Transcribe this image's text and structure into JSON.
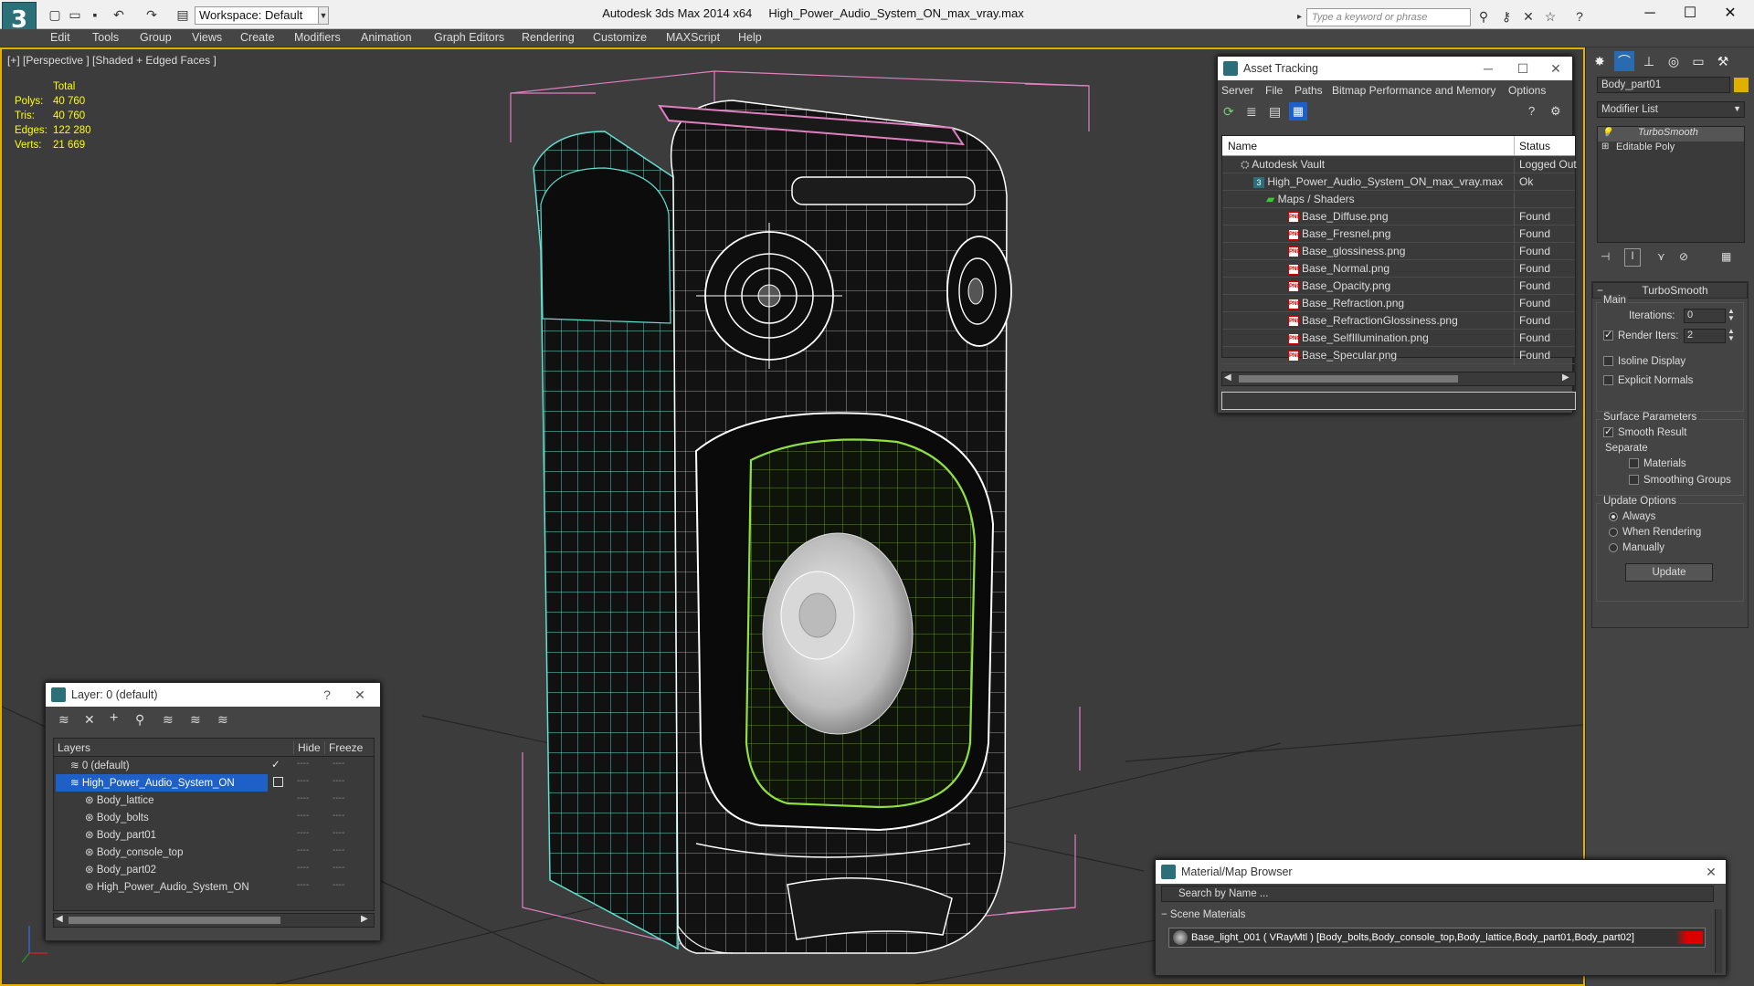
{
  "titlebar": {
    "logo": "3",
    "workspace": "Workspace: Default",
    "app_name": "Autodesk 3ds Max  2014 x64",
    "file_name": "High_Power_Audio_System_ON_max_vray.max",
    "search_placeholder": "Type a keyword or phrase"
  },
  "menu": [
    "Edit",
    "Tools",
    "Group",
    "Views",
    "Create",
    "Modifiers",
    "Animation",
    "Graph Editors",
    "Rendering",
    "Customize",
    "MAXScript",
    "Help"
  ],
  "viewport": {
    "label": "[+] [Perspective ] [Shaded + Edged Faces ]",
    "stats": {
      "header": "Total",
      "rows": [
        {
          "label": "Polys:",
          "value": "40 760"
        },
        {
          "label": "Tris:",
          "value": "40 760"
        },
        {
          "label": "Edges:",
          "value": "122 280"
        },
        {
          "label": "Verts:",
          "value": "21 669"
        }
      ]
    }
  },
  "asset_tracking": {
    "title": "Asset Tracking",
    "menu": [
      "Server",
      "File",
      "Paths",
      "Bitmap Performance and Memory",
      "Options"
    ],
    "columns": {
      "name": "Name",
      "status": "Status"
    },
    "rows": [
      {
        "name": "Autodesk Vault",
        "status": "Logged Out"
      },
      {
        "name": "High_Power_Audio_System_ON_max_vray.max",
        "status": "Ok"
      },
      {
        "name": "Maps / Shaders",
        "status": ""
      },
      {
        "name": "Base_Diffuse.png",
        "status": "Found"
      },
      {
        "name": "Base_Fresnel.png",
        "status": "Found"
      },
      {
        "name": "Base_glossiness.png",
        "status": "Found"
      },
      {
        "name": "Base_Normal.png",
        "status": "Found"
      },
      {
        "name": "Base_Opacity.png",
        "status": "Found"
      },
      {
        "name": "Base_Refraction.png",
        "status": "Found"
      },
      {
        "name": "Base_RefractionGlossiness.png",
        "status": "Found"
      },
      {
        "name": "Base_SelfIllumination.png",
        "status": "Found"
      },
      {
        "name": "Base_Specular.png",
        "status": "Found"
      }
    ],
    "png_badge": "PNG"
  },
  "command_panel": {
    "object_name": "Body_part01",
    "modifier_list": "Modifier List",
    "stack": [
      "TurboSmooth",
      "Editable Poly"
    ],
    "turbosmooth": {
      "title": "TurboSmooth",
      "main": "Main",
      "iterations_label": "Iterations:",
      "iterations_value": "0",
      "render_iters_label": "Render Iters:",
      "render_iters_value": "2",
      "isoline": "Isoline Display",
      "explicit_normals": "Explicit Normals",
      "surface_params": "Surface Parameters",
      "smooth_result": "Smooth Result",
      "separate": "Separate",
      "materials": "Materials",
      "smoothing_groups": "Smoothing Groups",
      "update_options": "Update Options",
      "always": "Always",
      "when_rendering": "When Rendering",
      "manually": "Manually",
      "update_button": "Update"
    }
  },
  "layer_dialog": {
    "title": "Layer: 0 (default)",
    "help": "?",
    "columns": {
      "layers": "Layers",
      "hide": "Hide",
      "freeze": "Freeze"
    },
    "rows": [
      {
        "name": "0 (default)"
      },
      {
        "name": "High_Power_Audio_System_ON"
      },
      {
        "name": "Body_lattice"
      },
      {
        "name": "Body_bolts"
      },
      {
        "name": "Body_part01"
      },
      {
        "name": "Body_console_top"
      },
      {
        "name": "Body_part02"
      },
      {
        "name": "High_Power_Audio_System_ON"
      }
    ],
    "dash": "----"
  },
  "material_browser": {
    "title": "Material/Map Browser",
    "search_placeholder": "Search by Name ...",
    "section": "Scene Materials",
    "material": "Base_light_001 ( VRayMtl ) [Body_bolts,Body_console_top,Body_lattice,Body_part01,Body_part02]"
  },
  "colors": {
    "accent_yellow": "#e0b000",
    "selection_blue": "#1e5fc8",
    "wire_cyan": "#60e0d0",
    "wire_green": "#90e040",
    "wire_pink": "#e080c0"
  }
}
